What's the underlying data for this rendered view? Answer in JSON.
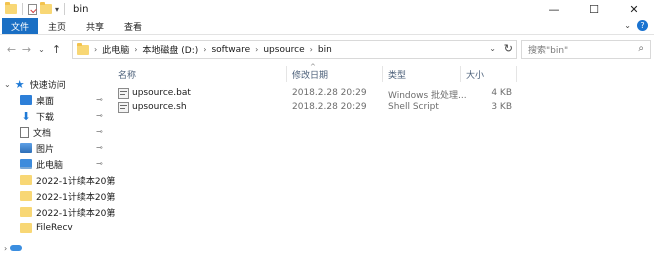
{
  "window": {
    "title": "bin",
    "controls": {
      "minimize": "—",
      "maximize": "☐",
      "close": "✕"
    }
  },
  "ribbon": {
    "tabs": [
      "文件",
      "主页",
      "共享",
      "查看"
    ],
    "expand_icon": "chevron-down-icon",
    "help_label": "?"
  },
  "address": {
    "back_icon": "←",
    "forward_icon": "→",
    "recent_icon": "⌄",
    "up_icon": "↑",
    "breadcrumbs": [
      "此电脑",
      "本地磁盘 (D:)",
      "software",
      "upsource",
      "bin"
    ],
    "separator": "›",
    "dropdown_icon": "⌄",
    "refresh_icon": "↻"
  },
  "search": {
    "placeholder": "搜索\"bin\"",
    "icon": "⌕"
  },
  "columns": {
    "name": "名称",
    "date": "修改日期",
    "type": "类型",
    "size": "大小",
    "sort_indicator": "^"
  },
  "files": [
    {
      "name": "upsource.bat",
      "date": "2018.2.28 20:29",
      "type": "Windows 批处理...",
      "size": "4 KB"
    },
    {
      "name": "upsource.sh",
      "date": "2018.2.28 20:29",
      "type": "Shell Script",
      "size": "3 KB"
    }
  ],
  "nav": {
    "quick_access": "快速访问",
    "items": [
      {
        "label": "桌面",
        "icon": "desktop-icon",
        "pinned": true
      },
      {
        "label": "下载",
        "icon": "download-icon",
        "pinned": true
      },
      {
        "label": "文档",
        "icon": "document-icon",
        "pinned": true
      },
      {
        "label": "图片",
        "icon": "pictures-icon",
        "pinned": true
      },
      {
        "label": "此电脑",
        "icon": "computer-icon",
        "pinned": true
      },
      {
        "label": "2022-1计续本20第",
        "icon": "folder-icon",
        "pinned": false
      },
      {
        "label": "2022-1计续本20第",
        "icon": "folder-icon",
        "pinned": false
      },
      {
        "label": "2022-1计续本20第",
        "icon": "folder-icon",
        "pinned": false
      },
      {
        "label": "FileRecv",
        "icon": "folder-icon",
        "pinned": false
      }
    ],
    "pin_glyph": "📌"
  }
}
